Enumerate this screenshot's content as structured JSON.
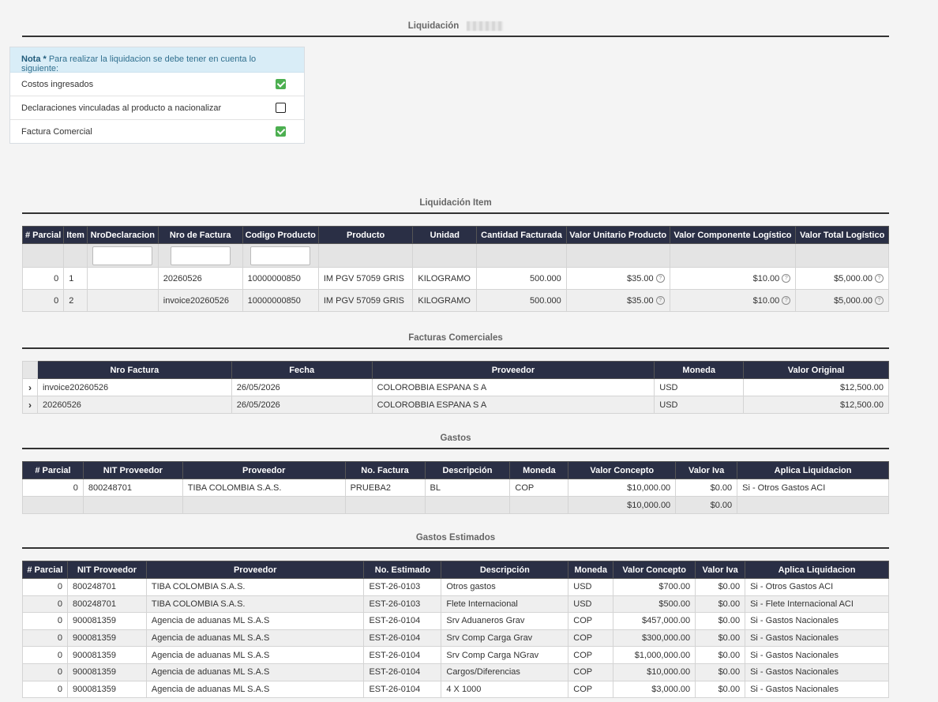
{
  "liquidacion": {
    "title": "Liquidación",
    "nota_label": "Nota *",
    "nota_text": " Para realizar la liquidacion se debe tener en cuenta lo siguiente:",
    "checks": [
      {
        "label": "Costos ingresados",
        "checked": true
      },
      {
        "label": "Declaraciones vinculadas al producto a nacionalizar",
        "checked": false
      },
      {
        "label": "Factura Comercial",
        "checked": true
      }
    ]
  },
  "liquidacion_item": {
    "title": "Liquidación Item",
    "headers": [
      "# Parcial",
      "Item",
      "NroDeclaracion",
      "Nro de Factura",
      "Codigo Producto",
      "Producto",
      "Unidad",
      "Cantidad Facturada",
      "Valor Unitario Producto",
      "Valor Componente Logístico",
      "Valor Total Logístico"
    ],
    "rows": [
      {
        "parcial": "0",
        "item": "1",
        "nro_declaracion": "",
        "nro_factura": "20260526",
        "codigo": "10000000850",
        "producto": "IM PGV 57059 GRIS",
        "unidad": "KILOGRAMO",
        "cantidad": "500.000",
        "valor_unitario": "$35.00",
        "valor_componente": "$10.00",
        "valor_total": "$5,000.00"
      },
      {
        "parcial": "0",
        "item": "2",
        "nro_declaracion": "",
        "nro_factura": "invoice20260526",
        "codigo": "10000000850",
        "producto": "IM PGV 57059 GRIS",
        "unidad": "KILOGRAMO",
        "cantidad": "500.000",
        "valor_unitario": "$35.00",
        "valor_componente": "$10.00",
        "valor_total": "$5,000.00"
      }
    ]
  },
  "facturas": {
    "title": "Facturas Comerciales",
    "headers": [
      "Nro Factura",
      "Fecha",
      "Proveedor",
      "Moneda",
      "Valor Original"
    ],
    "rows": [
      {
        "nro": "invoice20260526",
        "fecha": "26/05/2026",
        "proveedor": "COLOROBBIA ESPANA S A",
        "moneda": "USD",
        "valor": "$12,500.00"
      },
      {
        "nro": "20260526",
        "fecha": "26/05/2026",
        "proveedor": "COLOROBBIA ESPANA S A",
        "moneda": "USD",
        "valor": "$12,500.00"
      }
    ]
  },
  "gastos": {
    "title": "Gastos",
    "headers": [
      "# Parcial",
      "NIT Proveedor",
      "Proveedor",
      "No. Factura",
      "Descripción",
      "Moneda",
      "Valor Concepto",
      "Valor Iva",
      "Aplica Liquidacion"
    ],
    "rows": [
      {
        "parcial": "0",
        "nit": "800248701",
        "proveedor": "TIBA COLOMBIA S.A.S.",
        "factura": "PRUEBA2",
        "descripcion": "BL",
        "moneda": "COP",
        "valor": "$10,000.00",
        "iva": "$0.00",
        "aplica": "Si - Otros Gastos ACI"
      }
    ],
    "total_valor": "$10,000.00",
    "total_iva": "$0.00"
  },
  "gastos_estimados": {
    "title": "Gastos Estimados",
    "headers": [
      "# Parcial",
      "NIT Proveedor",
      "Proveedor",
      "No. Estimado",
      "Descripción",
      "Moneda",
      "Valor Concepto",
      "Valor Iva",
      "Aplica Liquidacion"
    ],
    "rows": [
      {
        "parcial": "0",
        "nit": "800248701",
        "proveedor": "TIBA COLOMBIA S.A.S.",
        "estimado": "EST-26-0103",
        "descripcion": "Otros gastos",
        "moneda": "USD",
        "valor": "$700.00",
        "iva": "$0.00",
        "aplica": "Si - Otros Gastos ACI"
      },
      {
        "parcial": "0",
        "nit": "800248701",
        "proveedor": "TIBA COLOMBIA S.A.S.",
        "estimado": "EST-26-0103",
        "descripcion": "Flete Internacional",
        "moneda": "USD",
        "valor": "$500.00",
        "iva": "$0.00",
        "aplica": "Si - Flete Internacional ACI"
      },
      {
        "parcial": "0",
        "nit": "900081359",
        "proveedor": "Agencia de aduanas ML S.A.S",
        "estimado": "EST-26-0104",
        "descripcion": "Srv Aduaneros Grav",
        "moneda": "COP",
        "valor": "$457,000.00",
        "iva": "$0.00",
        "aplica": "Si - Gastos Nacionales"
      },
      {
        "parcial": "0",
        "nit": "900081359",
        "proveedor": "Agencia de aduanas ML S.A.S",
        "estimado": "EST-26-0104",
        "descripcion": "Srv Comp Carga Grav",
        "moneda": "COP",
        "valor": "$300,000.00",
        "iva": "$0.00",
        "aplica": "Si - Gastos Nacionales"
      },
      {
        "parcial": "0",
        "nit": "900081359",
        "proveedor": "Agencia de aduanas ML S.A.S",
        "estimado": "EST-26-0104",
        "descripcion": "Srv Comp Carga NGrav",
        "moneda": "COP",
        "valor": "$1,000,000.00",
        "iva": "$0.00",
        "aplica": "Si - Gastos Nacionales"
      },
      {
        "parcial": "0",
        "nit": "900081359",
        "proveedor": "Agencia de aduanas ML S.A.S",
        "estimado": "EST-26-0104",
        "descripcion": "Cargos/Diferencias",
        "moneda": "COP",
        "valor": "$10,000.00",
        "iva": "$0.00",
        "aplica": "Si - Gastos Nacionales"
      },
      {
        "parcial": "0",
        "nit": "900081359",
        "proveedor": "Agencia de aduanas ML S.A.S",
        "estimado": "EST-26-0104",
        "descripcion": "4 X 1000",
        "moneda": "COP",
        "valor": "$3,000.00",
        "iva": "$0.00",
        "aplica": "Si - Gastos Nacionales"
      }
    ]
  }
}
